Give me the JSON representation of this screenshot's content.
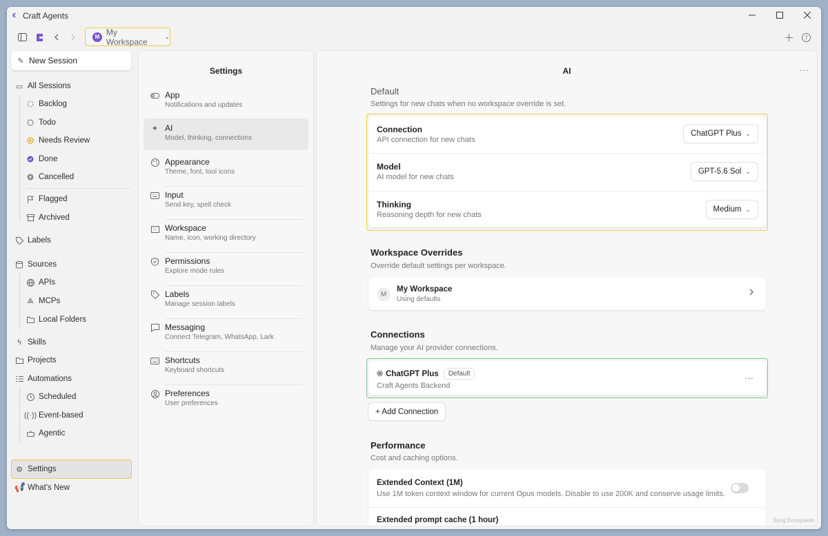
{
  "window": {
    "title": "Craft Agents"
  },
  "toolbar": {
    "workspace": "My Workspace",
    "workspace_initial": "M"
  },
  "sidebar": {
    "new_session": "New Session",
    "all_sessions": "All Sessions",
    "statuses": [
      "Backlog",
      "Todo",
      "Needs Review",
      "Done",
      "Cancelled"
    ],
    "flagged": "Flagged",
    "archived": "Archived",
    "labels": "Labels",
    "sources": "Sources",
    "source_items": [
      "APIs",
      "MCPs",
      "Local Folders"
    ],
    "skills": "Skills",
    "projects": "Projects",
    "automations": "Automations",
    "automation_items": [
      "Scheduled",
      "Event-based",
      "Agentic"
    ],
    "settings": "Settings",
    "whats_new": "What's New"
  },
  "settings_nav": {
    "title": "Settings",
    "items": [
      {
        "label": "App",
        "desc": "Notifications and updates",
        "icon": "toggle-icon"
      },
      {
        "label": "AI",
        "desc": "Model, thinking, connections",
        "icon": "sparkle-icon"
      },
      {
        "label": "Appearance",
        "desc": "Theme, font, tool icons",
        "icon": "palette-icon"
      },
      {
        "label": "Input",
        "desc": "Send key, spell check",
        "icon": "keyboard-icon"
      },
      {
        "label": "Workspace",
        "desc": "Name, icon, working directory",
        "icon": "building-icon"
      },
      {
        "label": "Permissions",
        "desc": "Explore mode rules",
        "icon": "shield-icon"
      },
      {
        "label": "Labels",
        "desc": "Manage session labels",
        "icon": "tag-icon"
      },
      {
        "label": "Messaging",
        "desc": "Connect Telegram, WhatsApp, Lark",
        "icon": "chat-icon"
      },
      {
        "label": "Shortcuts",
        "desc": "Keyboard shortcuts",
        "icon": "keyboard-icon"
      },
      {
        "label": "Preferences",
        "desc": "User preferences",
        "icon": "user-icon"
      }
    ]
  },
  "main": {
    "title": "AI",
    "default": {
      "title": "Default",
      "desc": "Settings for new chats when no workspace override is set.",
      "connection": {
        "label": "Connection",
        "desc": "API connection for new chats",
        "value": "ChatGPT Plus"
      },
      "model": {
        "label": "Model",
        "desc": "AI model for new chats",
        "value": "GPT-5.6 Sol"
      },
      "thinking": {
        "label": "Thinking",
        "desc": "Reasoning depth for new chats",
        "value": "Medium"
      }
    },
    "overrides": {
      "title": "Workspace Overrides",
      "desc": "Override default settings per workspace.",
      "workspace_initial": "M",
      "workspace_name": "My Workspace",
      "workspace_status": "Using defaults"
    },
    "connections": {
      "title": "Connections",
      "desc": "Manage your AI provider connections.",
      "name": "ChatGPT Plus",
      "badge": "Default",
      "backend": "Craft Agents Backend",
      "add_label": "+ Add Connection"
    },
    "performance": {
      "title": "Performance",
      "desc": "Cost and caching options.",
      "extended_context": {
        "label": "Extended Context (1M)",
        "desc": "Use 1M token context window for current Opus models. Disable to use 200K and conserve usage limits.",
        "enabled": false
      },
      "prompt_cache": {
        "label": "Extended prompt cache (1 hour)"
      }
    }
  },
  "watermark": "Song Ecosystem",
  "colors": {
    "accent": "#7a56c9",
    "highlight_yellow": "#f0c94a",
    "highlight_green": "#7cc48b"
  }
}
